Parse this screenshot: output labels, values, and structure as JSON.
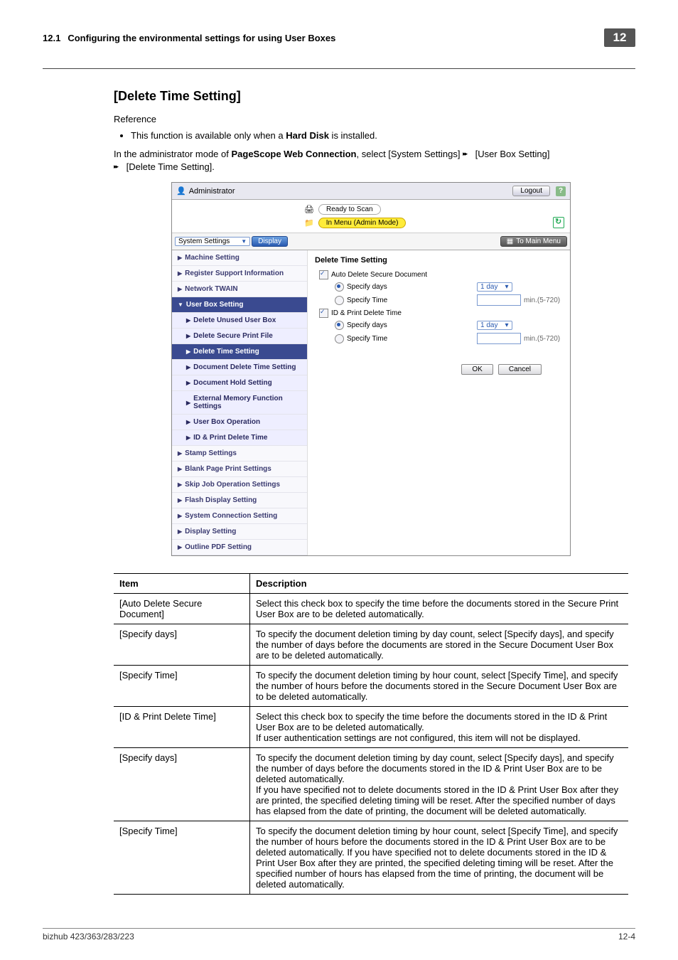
{
  "runhead": {
    "num": "12.1",
    "title": "Configuring the environmental settings for using User Boxes",
    "chapter": "12"
  },
  "section_title": "[Delete Time Setting]",
  "reference_label": "Reference",
  "bullet": "This function is available only when a ",
  "bullet_bold": "Hard Disk",
  "bullet_tail": " is installed.",
  "intro_a": "In the administrator mode of ",
  "intro_bold": "PageScope Web Connection",
  "intro_b": ", select [System Settings] ",
  "intro_c": " [User Box Setting] ",
  "intro_d": " [Delete Time Setting].",
  "shot": {
    "admin": "Administrator",
    "logout": "Logout",
    "ready": "Ready to Scan",
    "menu": "In Menu (Admin Mode)",
    "sys": "System Settings",
    "display": "Display",
    "to_main": "To Main Menu",
    "nav": {
      "machine": "Machine Setting",
      "regsup": "Register Support Information",
      "twain": "Network TWAIN",
      "userbox": "User Box Setting",
      "del_unused": "Delete Unused User Box",
      "del_secure": "Delete Secure Print File",
      "del_time": "Delete Time Setting",
      "doc_del": "Document Delete Time Setting",
      "doc_hold": "Document Hold Setting",
      "ext_mem": "External Memory Function Settings",
      "box_op": "User Box Operation",
      "id_print": "ID & Print Delete Time",
      "stamp": "Stamp Settings",
      "blank": "Blank Page Print Settings",
      "skip": "Skip Job Operation Settings",
      "flash": "Flash Display Setting",
      "sysconn": "System Connection Setting",
      "disp": "Display Setting",
      "outpdf": "Outline PDF Setting"
    },
    "pane": {
      "title": "Delete Time Setting",
      "auto_del": "Auto Delete Secure Document",
      "spec_days": "Specify days",
      "spec_time": "Specify Time",
      "id_del": "ID & Print Delete Time",
      "oneday": "1 day",
      "range": "min.(5-720)",
      "ok": "OK",
      "cancel": "Cancel"
    }
  },
  "table": {
    "h1": "Item",
    "h2": "Description",
    "rows": [
      {
        "item": "[Auto Delete Secure Document]",
        "desc": "Select this check box to specify the time before the documents stored in the Secure Print User Box are to be deleted automatically."
      },
      {
        "item": "[Specify days]",
        "desc": "To specify the document deletion timing by day count, select [Specify days], and specify the number of days before the documents are stored in the Secure Document User Box are to be deleted automatically."
      },
      {
        "item": "[Specify Time]",
        "desc": "To specify the document deletion timing by hour count, select [Specify Time], and specify the number of hours before the documents stored in the Secure Document User Box are to be deleted automatically."
      },
      {
        "item": "[ID & Print Delete Time]",
        "desc": "Select this check box to specify the time before the documents stored in the ID & Print User Box are to be deleted automatically.\nIf user authentication settings are not configured, this item will not be displayed."
      },
      {
        "item": "[Specify days]",
        "desc": "To specify the document deletion timing by day count, select [Specify days], and specify the number of days before the documents stored in the ID & Print User Box are to be deleted automatically.\nIf you have specified not to delete documents stored in the ID & Print User Box after they are printed, the specified deleting timing will be reset. After the specified number of days has elapsed from the date of printing, the document will be deleted automatically."
      },
      {
        "item": "[Specify Time]",
        "desc": "To specify the document deletion timing by hour count, select [Specify Time], and specify the number of hours before the documents stored in the ID & Print User Box are to be deleted automatically. If you have specified not to delete documents stored in the ID & Print User Box after they are printed, the specified deleting timing will be reset. After the specified number of hours has elapsed from the time of printing, the document will be deleted automatically."
      }
    ]
  },
  "foot": {
    "left": "bizhub 423/363/283/223",
    "right": "12-4"
  }
}
